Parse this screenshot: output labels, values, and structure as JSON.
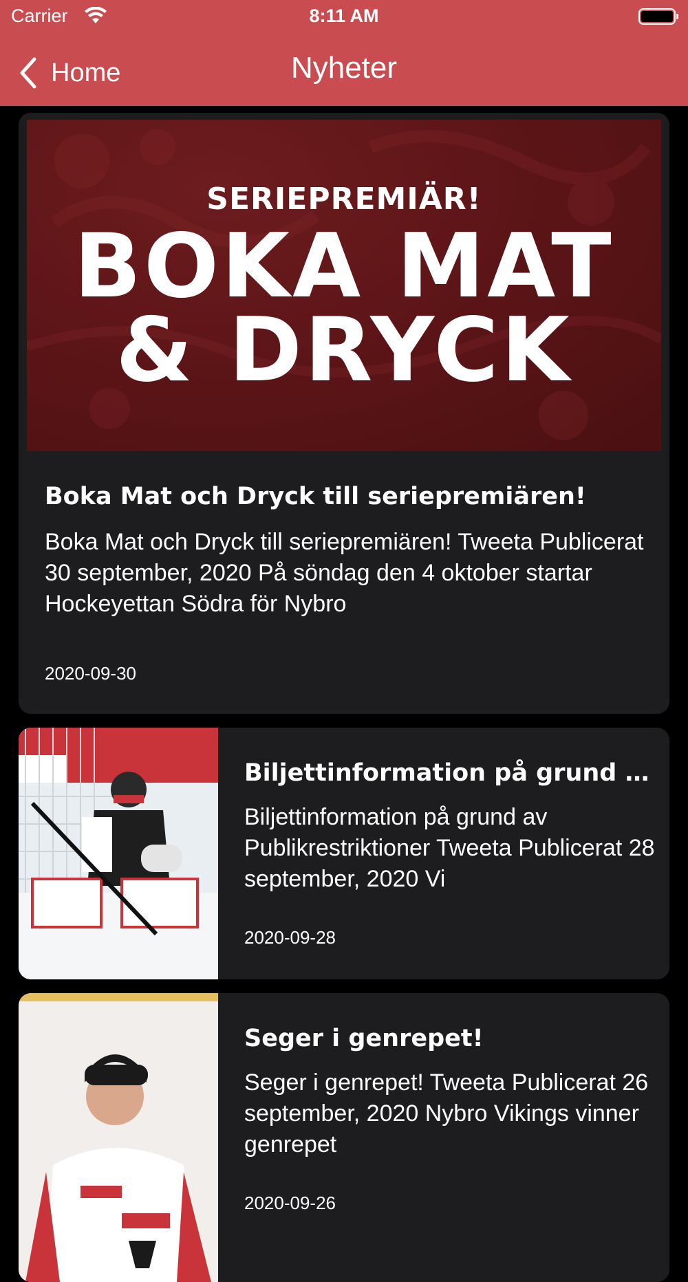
{
  "status_bar": {
    "carrier": "Carrier",
    "time": "8:11 AM"
  },
  "nav": {
    "back_label": "Home",
    "title": "Nyheter"
  },
  "featured": {
    "banner_kicker": "SERIEPREMIÄR!",
    "banner_line1": "BOKA MAT",
    "banner_line2": "& DRYCK",
    "title": "Boka Mat och Dryck till seriepremiären!",
    "excerpt": "Boka Mat och Dryck till seriepremiären! Tweeta Publicerat 30 september, 2020 På söndag den 4 oktober startar Hockeyettan Södra för Nybro",
    "date": "2020-09-30"
  },
  "articles": [
    {
      "title": "Biljettinformation på grund av Publikrestriktioner",
      "excerpt": "Biljettinformation på grund av Publikrestriktioner Tweeta Publicerat 28 september, 2020 Vi",
      "date": "2020-09-28"
    },
    {
      "title": "Seger i genrepet!",
      "excerpt": "Seger i genrepet! Tweeta Publicerat 26 september, 2020 Nybro Vikings vinner genrepet",
      "date": "2020-09-26"
    }
  ],
  "colors": {
    "header": "#c94c50",
    "card": "#1d1d1f",
    "banner": "#5a1416"
  }
}
